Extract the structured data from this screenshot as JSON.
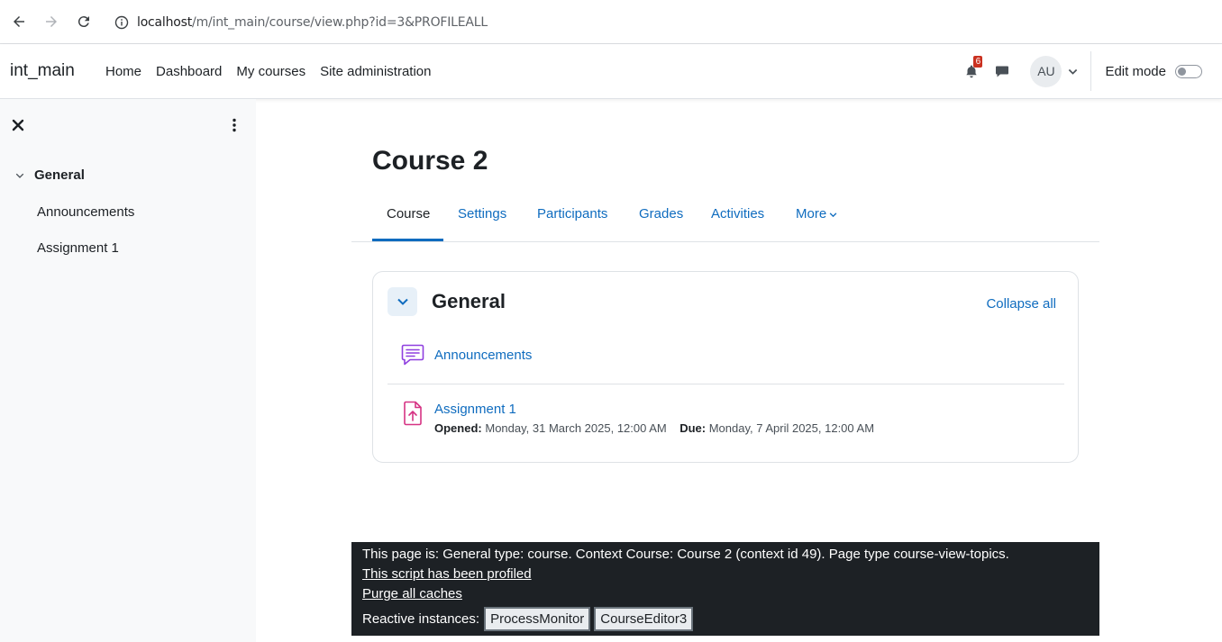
{
  "browser": {
    "url_host": "localhost",
    "url_path": "/m/int_main/course/view.php?id=3&PROFILEALL"
  },
  "navbar": {
    "brand": "int_main",
    "links": [
      "Home",
      "Dashboard",
      "My courses",
      "Site administration"
    ],
    "notification_count": "6",
    "avatar_initials": "AU",
    "edit_mode_label": "Edit mode"
  },
  "drawer": {
    "section_title": "General",
    "items": [
      "Announcements",
      "Assignment 1"
    ]
  },
  "main": {
    "course_title": "Course 2",
    "tabs": [
      "Course",
      "Settings",
      "Participants",
      "Grades",
      "Activities",
      "More"
    ],
    "section": {
      "title": "General",
      "collapse_all": "Collapse all",
      "activities": [
        {
          "name": "Announcements",
          "icon": "forum-icon"
        },
        {
          "name": "Assignment 1",
          "icon": "assignment-icon",
          "opened_label": "Opened:",
          "opened_value": "Monday, 31 March 2025, 12:00 AM",
          "due_label": "Due:",
          "due_value": "Monday, 7 April 2025, 12:00 AM"
        }
      ]
    }
  },
  "footer": {
    "page_info": "This page is: General type: course. Context Course: Course 2 (context id 49). Page type course-view-topics.",
    "profiled_link": "This script has been profiled",
    "purge_link": "Purge all caches",
    "reactive_label": "Reactive instances:",
    "reactive_buttons": [
      "ProcessMonitor",
      "CourseEditor3"
    ]
  },
  "colors": {
    "link": "#0f6cbf",
    "text": "#1d2125",
    "drawer_bg": "#f8f9fa",
    "footer_bg": "#1d2125",
    "badge": "#ca3120",
    "forum_icon": "#8f3fdf",
    "assign_icon": "#d63384"
  }
}
